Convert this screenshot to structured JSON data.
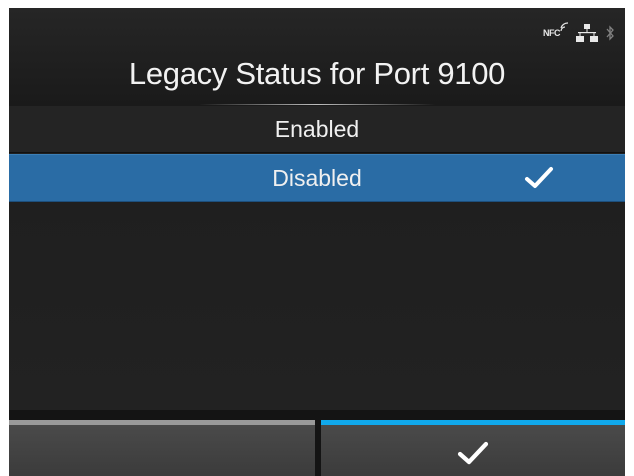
{
  "header": {
    "title": "Legacy Status for Port 9100",
    "status_icons": [
      "nfc-icon",
      "network-icon",
      "bluetooth-icon"
    ],
    "nfc_label": "NFC"
  },
  "options": [
    {
      "label": "Enabled",
      "selected": false
    },
    {
      "label": "Disabled",
      "selected": true
    }
  ],
  "footer": {
    "left_softkey": "",
    "right_softkey_icon": "check-icon"
  },
  "colors": {
    "selected_bg": "#2a6ca5",
    "accent_bar": "#11a9ec",
    "inactive_bar": "#9a9a9a"
  }
}
